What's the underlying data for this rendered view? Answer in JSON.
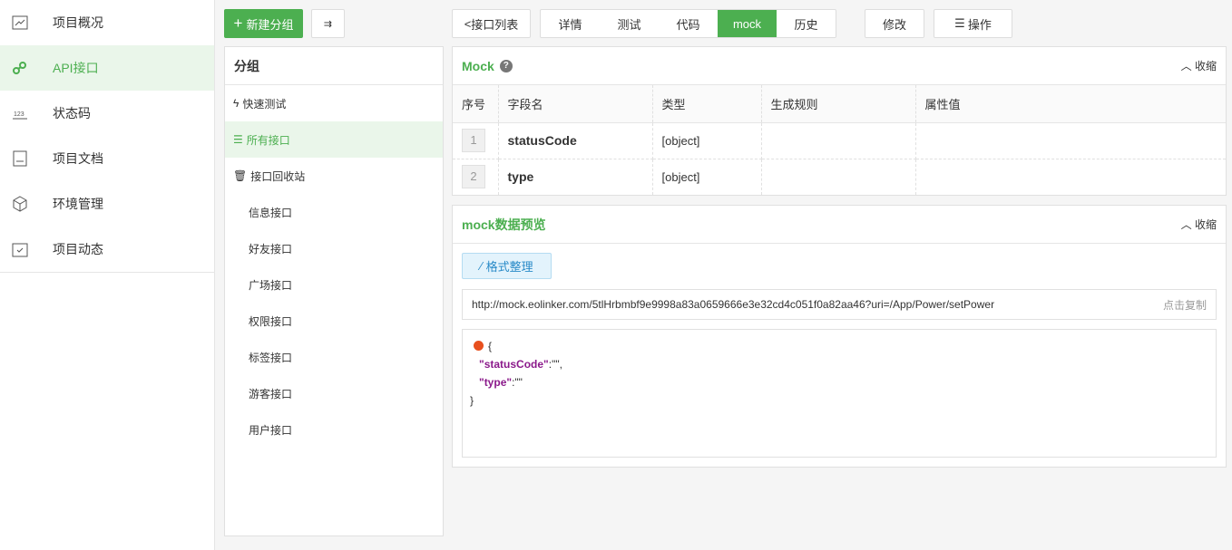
{
  "sidebar": {
    "items": [
      {
        "label": "项目概况",
        "icon": "chart-icon"
      },
      {
        "label": "API接口",
        "icon": "link-icon",
        "active": true
      },
      {
        "label": "状态码",
        "icon": "123-icon"
      },
      {
        "label": "项目文档",
        "icon": "document-icon"
      },
      {
        "label": "环境管理",
        "icon": "cube-icon"
      },
      {
        "label": "项目动态",
        "icon": "calendar-icon"
      }
    ]
  },
  "groups": {
    "new_group": "新建分组",
    "title": "分组",
    "items": [
      "快速测试",
      "所有接口",
      "接口回收站",
      "信息接口",
      "好友接口",
      "广场接口",
      "权限接口",
      "标签接口",
      "游客接口",
      "用户接口"
    ]
  },
  "toolbar": {
    "back": "接口列表",
    "tabs": [
      "详情",
      "测试",
      "代码",
      "mock",
      "历史"
    ],
    "active_tab": "mock",
    "edit": "修改",
    "ops": "操作"
  },
  "mock": {
    "title": "Mock",
    "collapse": "收缩",
    "columns": [
      "序号",
      "字段名",
      "类型",
      "生成规则",
      "属性值"
    ],
    "rows": [
      {
        "idx": "1",
        "name": "statusCode",
        "type": "[object]",
        "rule": "",
        "value": ""
      },
      {
        "idx": "2",
        "name": "type",
        "type": "[object]",
        "rule": "",
        "value": ""
      }
    ]
  },
  "preview": {
    "title": "mock数据预览",
    "collapse": "收缩",
    "format": "格式整理",
    "url": "http://mock.eolinker.com/5tlHrbmbf9e9998a83a0659666e3e32cd4c051f0a82aa46?uri=/App/Power/setPower",
    "copy": "点击复制",
    "code": {
      "open": "{",
      "k1": "\"statusCode\"",
      "v1": ":\"\",",
      "k2": "\"type\"",
      "v2": ":\"\"",
      "close": "}"
    }
  },
  "colors": {
    "accent": "#4caf50"
  }
}
